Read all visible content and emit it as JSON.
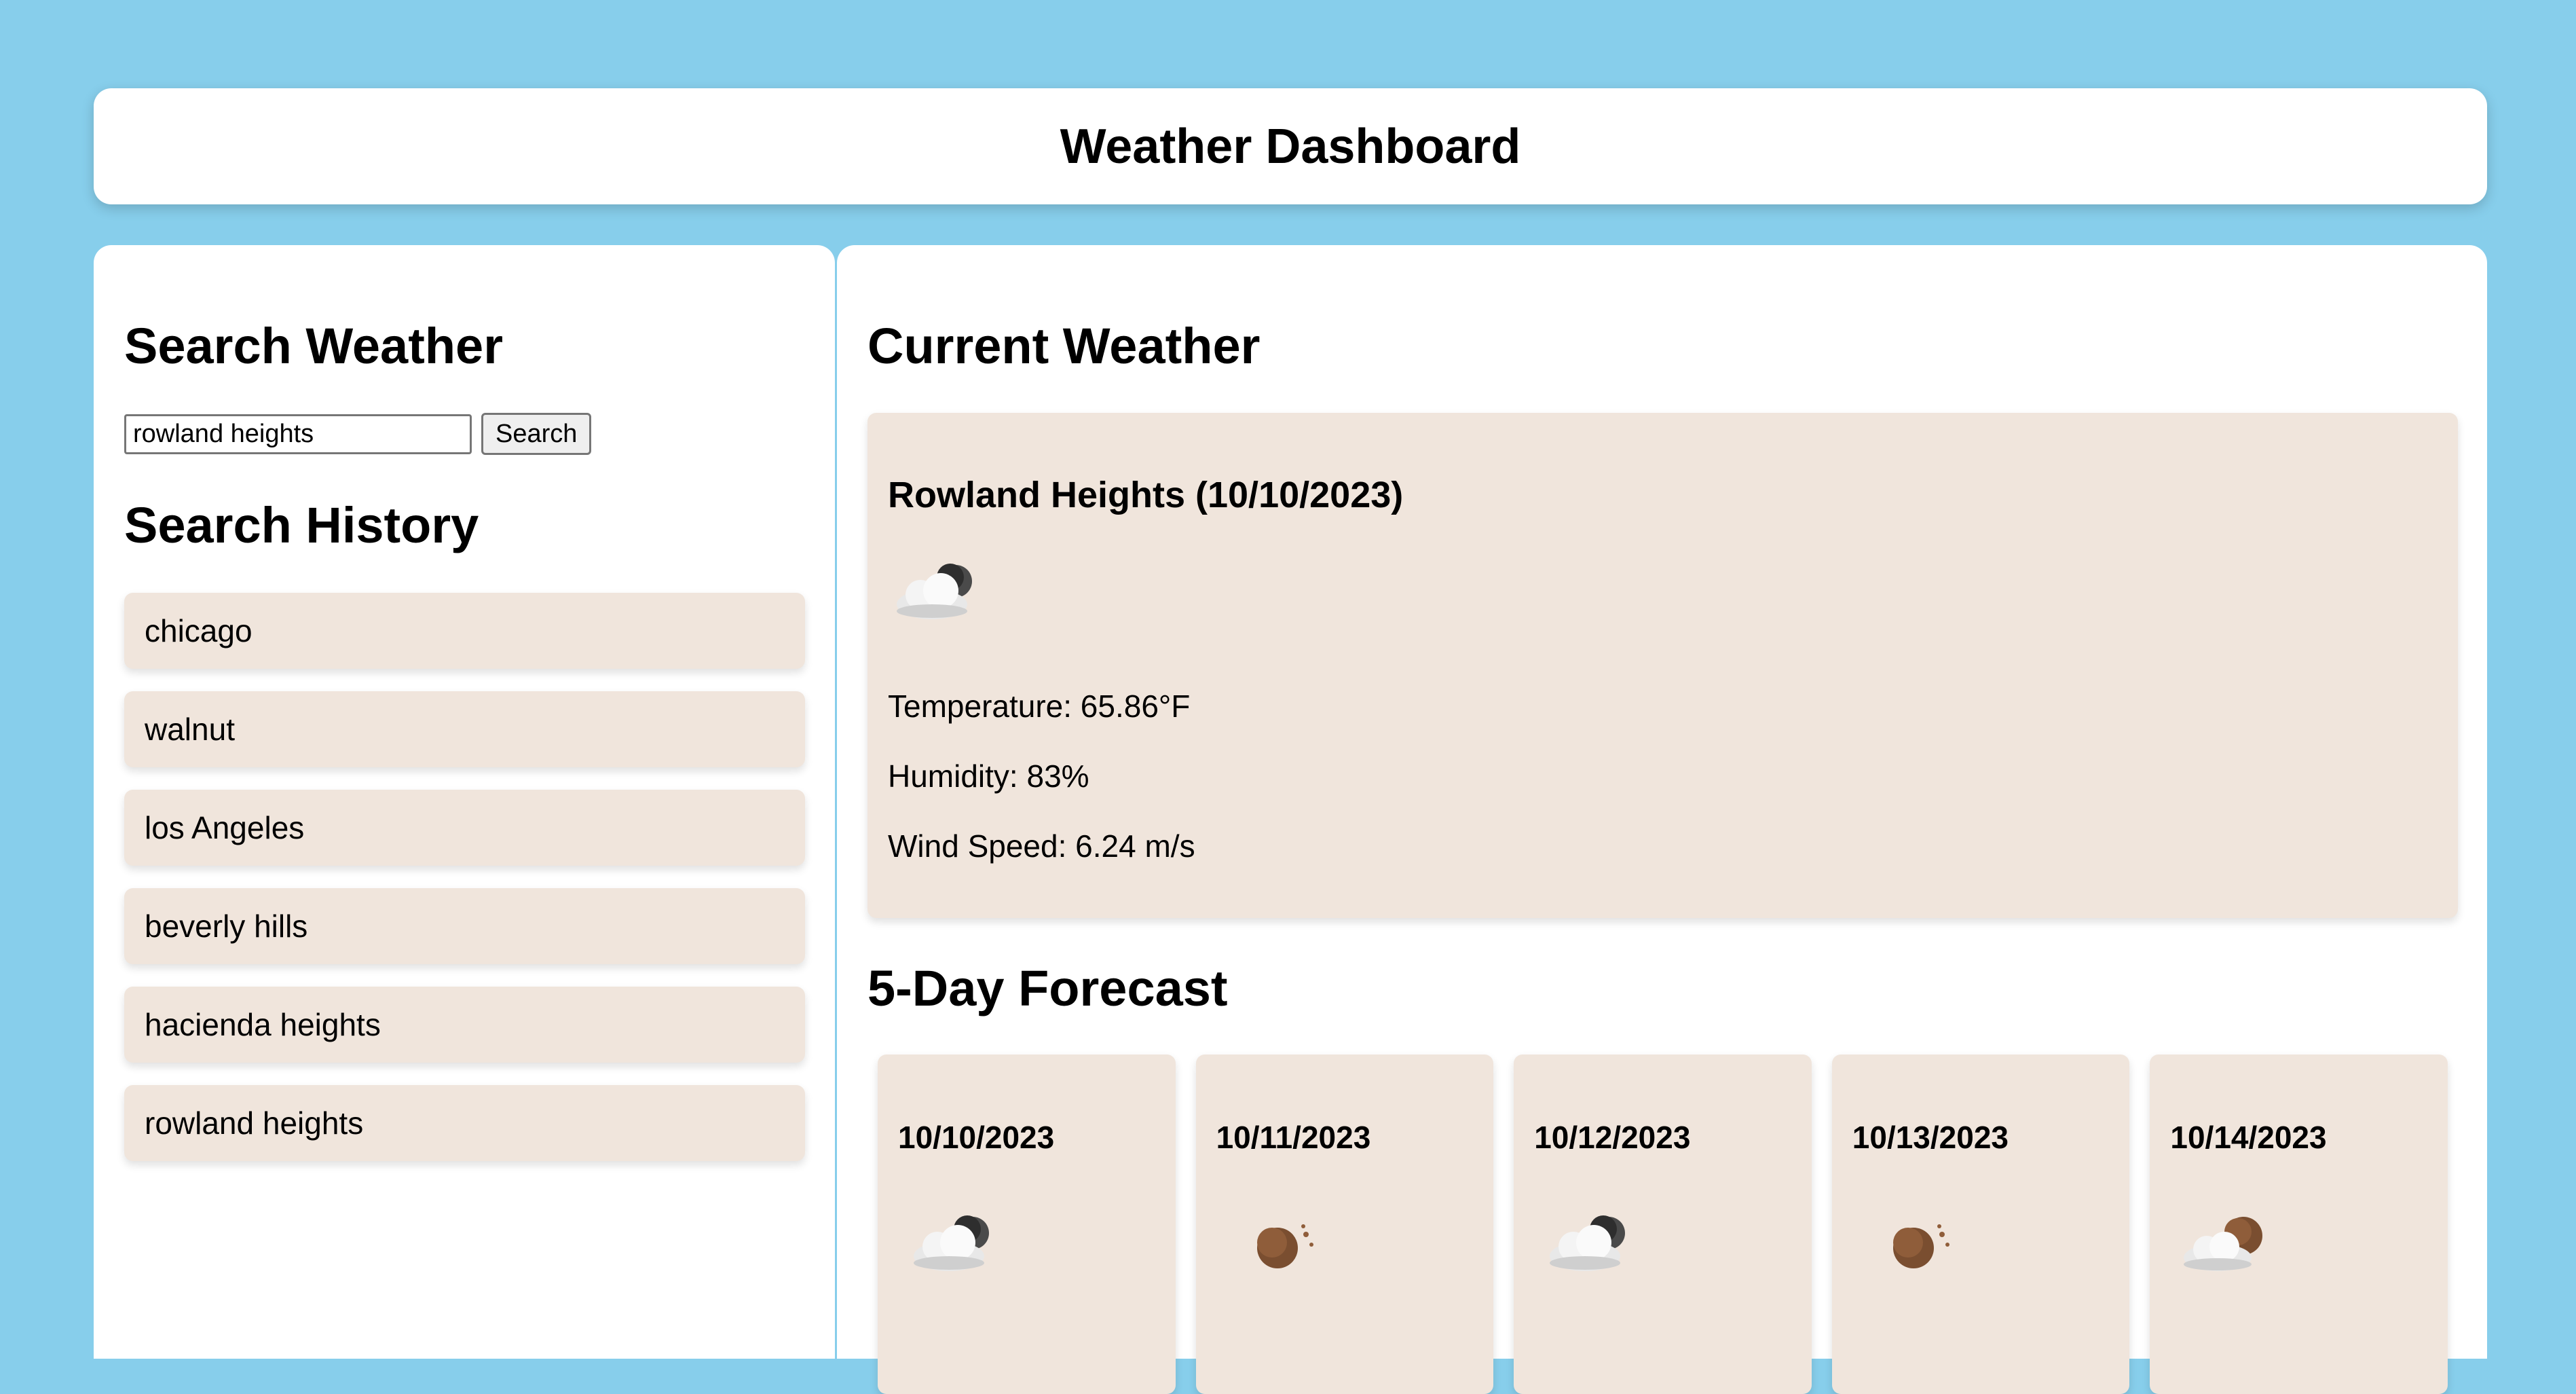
{
  "header": {
    "title": "Weather Dashboard"
  },
  "search": {
    "heading": "Search Weather",
    "input_value": "rowland heights",
    "button_label": "Search"
  },
  "history": {
    "heading": "Search History",
    "items": [
      {
        "label": "chicago"
      },
      {
        "label": "walnut"
      },
      {
        "label": "los Angeles"
      },
      {
        "label": "beverly hills"
      },
      {
        "label": "hacienda heights"
      },
      {
        "label": "rowland heights"
      }
    ]
  },
  "current": {
    "heading": "Current Weather",
    "title": "Rowland Heights (10/10/2023)",
    "icon": "cloudy-night-icon",
    "temperature": "Temperature: 65.86°F",
    "humidity": "Humidity: 83%",
    "wind": "Wind Speed: 6.24 m/s"
  },
  "forecast": {
    "heading": "5-Day Forecast",
    "days": [
      {
        "date": "10/10/2023",
        "icon": "cloudy-night-icon"
      },
      {
        "date": "10/11/2023",
        "icon": "clear-night-icon"
      },
      {
        "date": "10/12/2023",
        "icon": "cloudy-night-icon"
      },
      {
        "date": "10/13/2023",
        "icon": "clear-night-icon"
      },
      {
        "date": "10/14/2023",
        "icon": "partly-cloudy-night-icon"
      }
    ]
  },
  "colors": {
    "background": "#87ceeb",
    "card": "#f0e5dc",
    "panel": "#ffffff"
  }
}
